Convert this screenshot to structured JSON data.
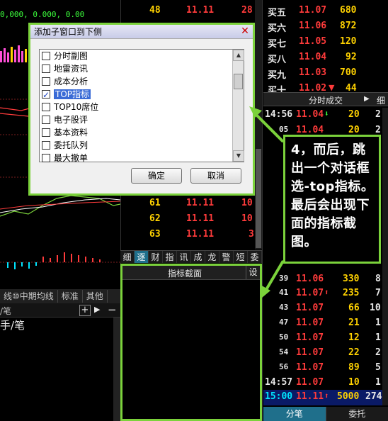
{
  "left_chart": {
    "top_numbers": "0,000, 0.000, 0.00",
    "tabs": [
      "线⑩中期均线",
      "标准",
      "其他"
    ],
    "sub_header": "/笔",
    "sub_header2": "手/笔"
  },
  "mid_rows_top": [
    {
      "a": "48",
      "b": "11.11",
      "c": "28"
    }
  ],
  "mid_rows_bottom": [
    {
      "a": "61",
      "b": "11.11",
      "c": "10"
    },
    {
      "a": "62",
      "b": "11.11",
      "c": "10"
    },
    {
      "a": "63",
      "b": "11.11",
      "c": "3"
    }
  ],
  "order_book": [
    {
      "label": "买五",
      "price": "11.07",
      "vol": "680"
    },
    {
      "label": "买六",
      "price": "11.06",
      "vol": "872"
    },
    {
      "label": "买七",
      "price": "11.05",
      "vol": "120"
    },
    {
      "label": "买八",
      "price": "11.04",
      "vol": "92"
    },
    {
      "label": "买九",
      "price": "11.03",
      "vol": "700"
    },
    {
      "label": "买十",
      "price": "11.02",
      "vol": "44"
    }
  ],
  "ticks_panel": {
    "title": "分时成交",
    "extra": "细",
    "rows": [
      {
        "time": "14:56",
        "price": "11.04",
        "arrow": "down",
        "vol": "20",
        "n": "2"
      },
      {
        "time": "05",
        "price": "11.04",
        "arrow": "",
        "vol": "20",
        "n": "2"
      },
      {
        "time": "39",
        "price": "11.06",
        "arrow": "",
        "vol": "330",
        "n": "8"
      },
      {
        "time": "41",
        "price": "11.07",
        "arrow": "up",
        "vol": "235",
        "n": "7"
      },
      {
        "time": "43",
        "price": "11.07",
        "arrow": "",
        "vol": "66",
        "n": "10"
      },
      {
        "time": "47",
        "price": "11.07",
        "arrow": "",
        "vol": "21",
        "n": "1"
      },
      {
        "time": "50",
        "price": "11.07",
        "arrow": "",
        "vol": "12",
        "n": "1"
      },
      {
        "time": "54",
        "price": "11.07",
        "arrow": "",
        "vol": "22",
        "n": "2"
      },
      {
        "time": "56",
        "price": "11.07",
        "arrow": "",
        "vol": "89",
        "n": "5"
      },
      {
        "time": "14:57",
        "price": "11.07",
        "arrow": "",
        "vol": "10",
        "n": "1"
      },
      {
        "time": "15:00",
        "price": "11.11",
        "arrow": "up",
        "vol": "5000",
        "n": "274"
      }
    ],
    "bottom_tabs": [
      "分笔",
      "委托"
    ]
  },
  "vertical_tabs": [
    "细",
    "逐",
    "财",
    "指",
    "讯",
    "成",
    "龙",
    "警",
    "短",
    "委"
  ],
  "indicator_panel": {
    "title": "指标截面",
    "settings": "设"
  },
  "dialog": {
    "title": "添加子窗口到下侧",
    "close": "✕",
    "items": [
      {
        "label": "分时副图",
        "checked": false
      },
      {
        "label": "地雷资讯",
        "checked": false
      },
      {
        "label": "成本分析",
        "checked": false
      },
      {
        "label": "TOP指标",
        "checked": true
      },
      {
        "label": "TOP10席位",
        "checked": false
      },
      {
        "label": "电子股评",
        "checked": false
      },
      {
        "label": "基本资料",
        "checked": false
      },
      {
        "label": "委托队列",
        "checked": false
      },
      {
        "label": "最大撤单",
        "checked": false
      }
    ],
    "ok": "确定",
    "cancel": "取消"
  },
  "annotation": {
    "text": "4，而后，跳出一个对话框选-top指标。最后会出现下面的指标截图。"
  }
}
